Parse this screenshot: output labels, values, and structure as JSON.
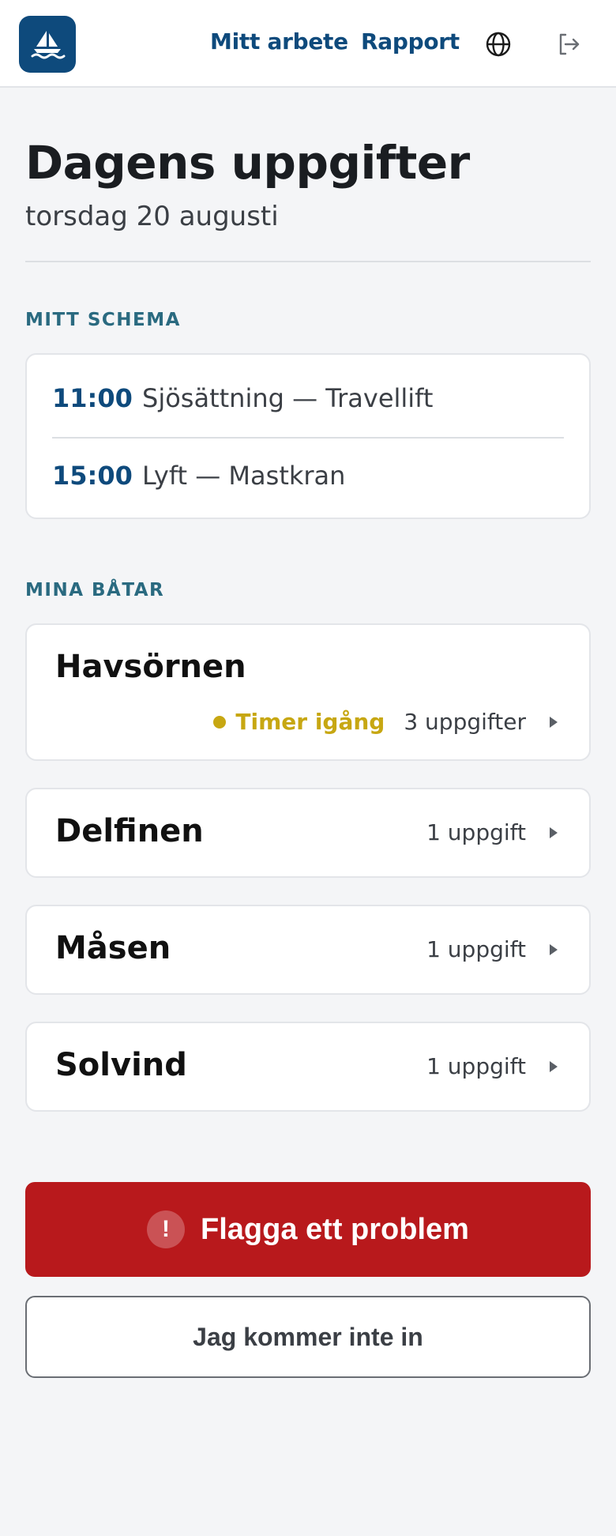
{
  "header": {
    "logo_icon": "sailboat-icon",
    "nav_work": "Mitt arbete",
    "nav_report": "Rapport",
    "language_icon": "globe-icon",
    "logout_icon": "logout-icon",
    "brand_color": "#0e4a7c"
  },
  "page": {
    "title": "Dagens uppgifter",
    "date": "torsdag 20 augusti"
  },
  "schedule": {
    "label": "MITT SCHEMA",
    "items": [
      {
        "time": "11:00",
        "text": "Sjösättning — Travellift"
      },
      {
        "time": "15:00",
        "text": "Lyft — Mastkran"
      }
    ]
  },
  "boats": {
    "label": "MINA BÅTAR",
    "items": [
      {
        "name": "Havsörnen",
        "status": "Timer igång",
        "tasks": "3 uppgifter",
        "status_color": "#c7a712"
      },
      {
        "name": "Delfinen",
        "tasks": "1 uppgift"
      },
      {
        "name": "Måsen",
        "tasks": "1 uppgift"
      },
      {
        "name": "Solvind",
        "tasks": "1 uppgift"
      }
    ]
  },
  "actions": {
    "flag_label": "Flagga ett problem",
    "flag_icon": "exclamation-icon",
    "flag_color": "#b8191c",
    "cant_enter_label": "Jag kommer inte in"
  }
}
